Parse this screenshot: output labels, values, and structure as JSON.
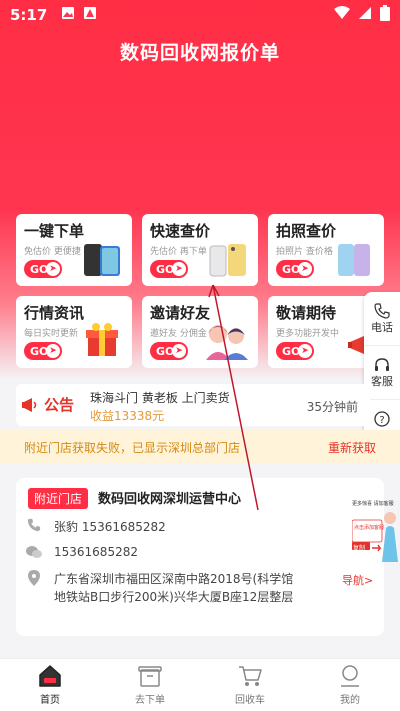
{
  "status": {
    "time": "5:17"
  },
  "header": {
    "title": "数码回收网报价单"
  },
  "cards": [
    {
      "title": "一键下单",
      "subtitle": "免估价 更便捷",
      "go": "GO"
    },
    {
      "title": "快速查价",
      "subtitle": "先估价 再下单",
      "go": "GO"
    },
    {
      "title": "拍照查价",
      "subtitle": "拍照片 查价格",
      "go": "GO"
    },
    {
      "title": "行情资讯",
      "subtitle": "每日实时更新",
      "go": "GO"
    },
    {
      "title": "邀请好友",
      "subtitle": "邀好友 分佣金",
      "go": "GO"
    },
    {
      "title": "敬请期待",
      "subtitle": "更多功能开发中",
      "go": "GO"
    }
  ],
  "sidebar": {
    "phone": "电话",
    "service": "客服",
    "question": "问题"
  },
  "notice": {
    "label": "公告",
    "text": "珠海斗门 黄老板 上门卖货",
    "bonus": "收益13338元",
    "time": "35分钟前"
  },
  "banner": {
    "message": "附近门店获取失败，已显示深圳总部门店",
    "action": "重新获取"
  },
  "store": {
    "tag": "附近门店",
    "name": "数码回收网深圳运营中心",
    "contact": "张豹 15361685282",
    "wechat": "15361685282",
    "address": "广东省深圳市福田区深南中路2018号(科学馆地铁站B口步行200米)兴华大厦B座12层整层",
    "nav": "导航>",
    "promo_top": "更多惊喜 请加客服",
    "promo_mid": "点击添加客服",
    "promo_bot": "复制"
  },
  "tabs": [
    {
      "label": "首页",
      "icon": "home-icon"
    },
    {
      "label": "去下单",
      "icon": "order-icon"
    },
    {
      "label": "回收车",
      "icon": "cart-icon"
    },
    {
      "label": "我的",
      "icon": "user-icon"
    }
  ],
  "colors": {
    "brand": "#ff2e45",
    "notice": "#e6332a",
    "banner_bg": "#fff4d9"
  }
}
